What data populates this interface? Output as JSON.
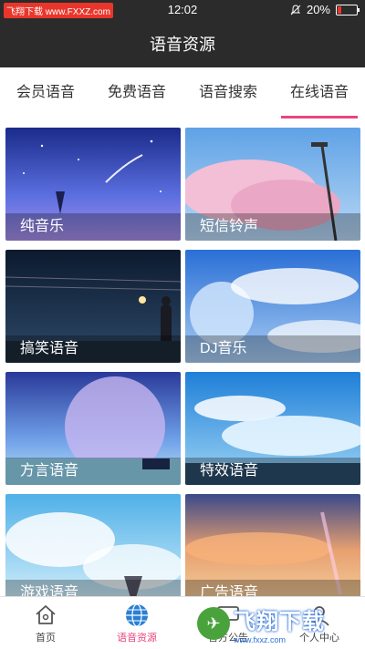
{
  "status": {
    "left_label": "飞翔下载 www.FXXZ.com",
    "time": "12:02",
    "battery": "20%",
    "battery_level": 0.2,
    "battery_color": "#e8362c"
  },
  "header": {
    "title": "语音资源"
  },
  "tabs": [
    {
      "label": "会员语音"
    },
    {
      "label": "免费语音"
    },
    {
      "label": "语音搜索"
    },
    {
      "label": "在线语音",
      "active": true
    }
  ],
  "tiles": [
    {
      "label": "纯音乐"
    },
    {
      "label": "短信铃声"
    },
    {
      "label": "搞笑语音"
    },
    {
      "label": "DJ音乐"
    },
    {
      "label": "方言语音"
    },
    {
      "label": "特效语音"
    },
    {
      "label": "游戏语音"
    },
    {
      "label": "广告语音"
    }
  ],
  "nav": [
    {
      "label": "首页",
      "icon": "home-icon"
    },
    {
      "label": "语音资源",
      "icon": "globe-icon",
      "active": true
    },
    {
      "label": "官方公告",
      "icon": "chat-icon"
    },
    {
      "label": "个人中心",
      "icon": "user-icon"
    }
  ],
  "watermark": {
    "brand": "飞翔下载",
    "url": "www.fxxz.com"
  },
  "colors": {
    "accent": "#e8457c",
    "header_bg": "#2b2b2b"
  }
}
